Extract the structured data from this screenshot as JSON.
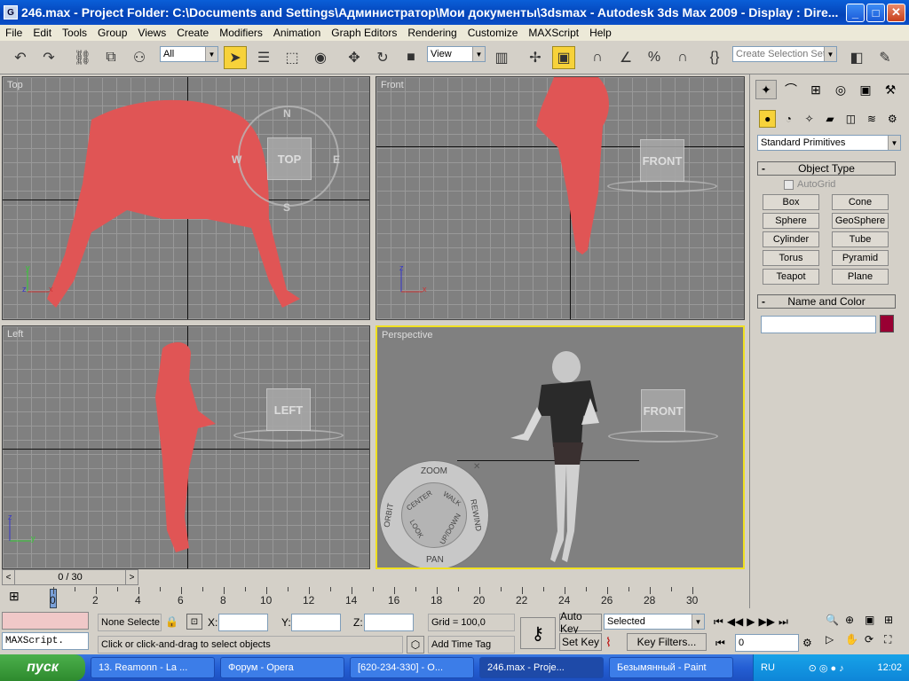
{
  "window": {
    "title": "246.max      - Project Folder: C:\\Documents and Settings\\Администратор\\Мои документы\\3dsmax      - Autodesk 3ds Max  2009      - Display : Dire...",
    "min": "_",
    "max": "□",
    "close": "✕"
  },
  "menu": [
    "File",
    "Edit",
    "Tools",
    "Group",
    "Views",
    "Create",
    "Modifiers",
    "Animation",
    "Graph Editors",
    "Rendering",
    "Customize",
    "MAXScript",
    "Help"
  ],
  "toolbar": {
    "filter_value": "All",
    "refcoord_value": "View",
    "selection_set_placeholder": "Create Selection Set",
    "icons": [
      "undo-icon",
      "redo-icon",
      "link-icon",
      "unlink-icon",
      "bind-spacewarp-icon",
      "select-icon",
      "select-by-name-icon",
      "region-select-icon",
      "window-crossing-icon",
      "move-icon",
      "rotate-icon",
      "scale-icon",
      "pivot-icon",
      "manipulate-icon",
      "keyboard-shortcut-icon",
      "snap-icon",
      "angle-snap-icon",
      "percent-snap-icon",
      "spinner-snap-icon",
      "named-selection-icon",
      "mirror-icon",
      "align-icon"
    ]
  },
  "viewports": {
    "top": {
      "label": "Top",
      "cube": "TOP",
      "compass": [
        "N",
        "W",
        "E",
        "S"
      ]
    },
    "front": {
      "label": "Front",
      "cube": "FRONT"
    },
    "left": {
      "label": "Left",
      "cube": "LEFT"
    },
    "perspective": {
      "label": "Perspective",
      "cube": "FRONT"
    }
  },
  "steering_wheel": {
    "zoom": "ZOOM",
    "center": "CENTER",
    "walk": "WALK",
    "orbit": "ORBIT",
    "look": "LOOK",
    "updown": "UP/DOWN",
    "rewind": "REWIND",
    "pan": "PAN",
    "close": "✕"
  },
  "command_panel": {
    "category": "Standard Primitives",
    "object_type_header": "Object Type",
    "autogrid": "AutoGrid",
    "buttons": [
      "Box",
      "Cone",
      "Sphere",
      "GeoSphere",
      "Cylinder",
      "Tube",
      "Torus",
      "Pyramid",
      "Teapot",
      "Plane"
    ],
    "name_color_header": "Name and Color",
    "name_value": "",
    "color": "#990033"
  },
  "timeline": {
    "slider_label": "0 / 30",
    "ticks": [
      "0",
      "2",
      "4",
      "6",
      "8",
      "10",
      "12",
      "14",
      "16",
      "18",
      "20",
      "22",
      "24",
      "26",
      "28",
      "30"
    ]
  },
  "status": {
    "maxscript": "MAXScript.",
    "selection": "None Selecte",
    "x_label": "X:",
    "y_label": "Y:",
    "z_label": "Z:",
    "grid": "Grid = 100,0",
    "prompt": "Click or click-and-drag to select objects",
    "add_time_tag": "Add Time Tag",
    "auto_key": "Auto Key",
    "set_key": "Set Key",
    "key_mode": "Selected",
    "key_filters": "Key Filters...",
    "frame_value": "0"
  },
  "taskbar": {
    "start": "пуск",
    "tasks": [
      "13. Reamonn - La ...",
      "Форум - Opera",
      "[620-234-330] - O...",
      "246.max   - Proje...",
      "Безымянный - Paint"
    ],
    "lang": "RU",
    "clock": "12:02"
  },
  "colors": {
    "figure": "#e05555",
    "active_border": "#f0e020",
    "accent": "#f7d23a"
  }
}
